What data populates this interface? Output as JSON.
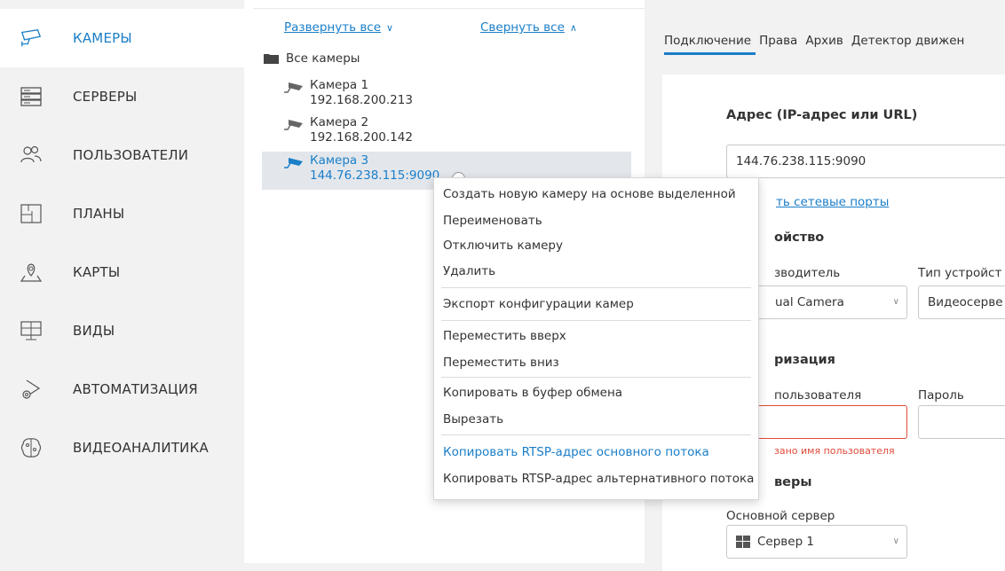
{
  "sidebar": {
    "items": [
      {
        "label": "КАМЕРЫ",
        "icon": "camera-icon",
        "active": true
      },
      {
        "label": "СЕРВЕРЫ",
        "icon": "server-icon"
      },
      {
        "label": "ПОЛЬЗОВАТЕЛИ",
        "icon": "users-icon"
      },
      {
        "label": "ПЛАНЫ",
        "icon": "plans-icon"
      },
      {
        "label": "КАРТЫ",
        "icon": "map-pin-icon"
      },
      {
        "label": "ВИДЫ",
        "icon": "monitor-icon"
      },
      {
        "label": "АВТОМАТИЗАЦИЯ",
        "icon": "automation-gear-icon"
      },
      {
        "label": "ВИДЕОАНАЛИТИКА",
        "icon": "brain-icon"
      }
    ]
  },
  "tree": {
    "expand_all": "Развернуть все",
    "collapse_all": "Свернуть все",
    "root": "Все камеры",
    "cameras": [
      {
        "name": "Камера 1",
        "ip": "192.168.200.213"
      },
      {
        "name": "Камера 2",
        "ip": "192.168.200.142"
      },
      {
        "name": "Камера 3",
        "ip": "144.76.238.115:9090",
        "selected": true
      }
    ]
  },
  "context_menu": {
    "groups": [
      [
        "Создать новую камеру на основе выделенной",
        "Переименовать",
        "Отключить камеру",
        "Удалить"
      ],
      [
        "Экспорт конфигурации камер"
      ],
      [
        "Переместить вверх",
        "Переместить вниз"
      ],
      [
        "Копировать в буфер обмена",
        "Вырезать"
      ],
      [
        "Копировать RTSP-адрес основного потока",
        "Копировать RTSP-адрес альтернативного потока"
      ]
    ],
    "highlighted": "Копировать RTSP-адрес основного потока"
  },
  "tabs": [
    "Подключение",
    "Права",
    "Архив",
    "Детектор движен"
  ],
  "form": {
    "address_title": "Адрес (IP-адрес или URL)",
    "address_value": "144.76.238.115:9090",
    "ports_link": "ть сетевые порты",
    "device_title": "ойство",
    "manufacturer_label": "зводитель",
    "manufacturer_value": "ual Camera",
    "device_type_label": "Тип устройст",
    "device_type_value": "Видеосерве",
    "auth_title": "ризация",
    "username_label": "пользователя",
    "password_label": "Пароль",
    "username_error": "зано имя пользователя",
    "servers_title": "веры",
    "main_server_label": "Основной сервер",
    "main_server_value": "Сервер 1"
  },
  "colors": {
    "accent": "#1a7ec8",
    "error": "#e04a3a",
    "sidebar_bg": "#f2f2f2",
    "selected_row": "#e3e7ec"
  }
}
